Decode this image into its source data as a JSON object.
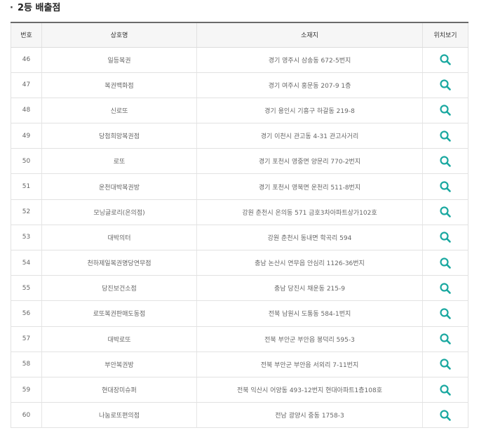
{
  "section": {
    "title": "2등 배출점"
  },
  "table": {
    "headers": [
      "번호",
      "상호명",
      "소재지",
      "위치보기"
    ],
    "rows": [
      {
        "no": "46",
        "name": "일등복권",
        "address": "경기 영주시 삼송동 672-5번지"
      },
      {
        "no": "47",
        "name": "복권백화점",
        "address": "경기 여주시 홍문동 207-9 1층"
      },
      {
        "no": "48",
        "name": "신로또",
        "address": "경기 용인시 기흥구 하갈동 219-8"
      },
      {
        "no": "49",
        "name": "당첨희망복권점",
        "address": "경기 이천시 관고동 4-31 관고사거리"
      },
      {
        "no": "50",
        "name": "로또",
        "address": "경기 포천시 영중면 양문리 770-2번지"
      },
      {
        "no": "51",
        "name": "운천대박복권방",
        "address": "경기 포천시 영북면 운천리 511-8번지"
      },
      {
        "no": "52",
        "name": "모닝글로리(온의점)",
        "address": "강원 춘천시 온의동 571 금호3차아파트상가102호"
      },
      {
        "no": "53",
        "name": "대박의터",
        "address": "강원 춘천시 동내면 학곡리 594"
      },
      {
        "no": "54",
        "name": "천하제일복권명당연무점",
        "address": "충남 논산시 연무읍 안심리 1126-36번지"
      },
      {
        "no": "55",
        "name": "당진보건소점",
        "address": "충남 당진시 채운동 215-9"
      },
      {
        "no": "56",
        "name": "로또복권판매도동점",
        "address": "전북 남원시 도통동 584-1번지"
      },
      {
        "no": "57",
        "name": "대박로또",
        "address": "전북 부안군 부안읍 봉덕리 595-3"
      },
      {
        "no": "58",
        "name": "부안복권방",
        "address": "전북 부안군 부안읍 서외리 7-11번지"
      },
      {
        "no": "59",
        "name": "현대장미슈퍼",
        "address": "전북 익산시 어양동 493-12번지 현대아파트1층108호"
      },
      {
        "no": "60",
        "name": "나눔로또편의점",
        "address": "전남 광양시 중동 1758-3"
      }
    ]
  },
  "icons": {
    "location": "search-icon"
  },
  "colors": {
    "accent": "#1aa8a0",
    "header_bg": "#f6f6f6",
    "header_border": "#6a6a6a"
  }
}
